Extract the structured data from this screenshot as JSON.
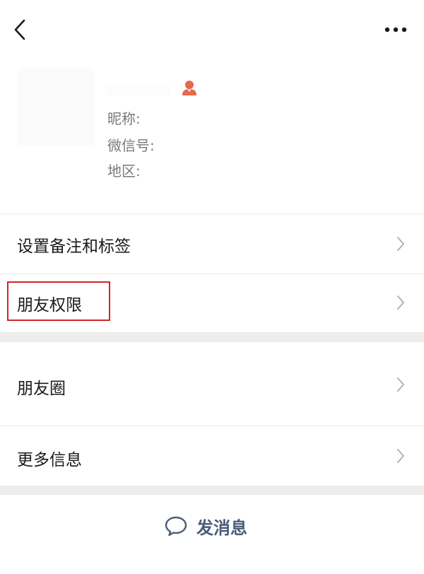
{
  "topbar": {
    "back_icon": "chevron-left-icon",
    "more_icon": "more-dots-icon"
  },
  "profile": {
    "gender_icon": "female-user-icon",
    "gender_icon_color": "#e8684a",
    "nickname_label": "昵称:",
    "wechat_id_label": "微信号:",
    "region_label": "地区:"
  },
  "menu": {
    "remark_tags": "设置备注和标签",
    "friend_permissions": "朋友权限",
    "moments": "朋友圈",
    "more_info": "更多信息"
  },
  "actions": {
    "send_message": "发消息",
    "send_icon": "chat-bubble-icon"
  },
  "colors": {
    "highlight": "#d0242b",
    "action_text": "#4a5b7a",
    "gap": "#ededed"
  }
}
